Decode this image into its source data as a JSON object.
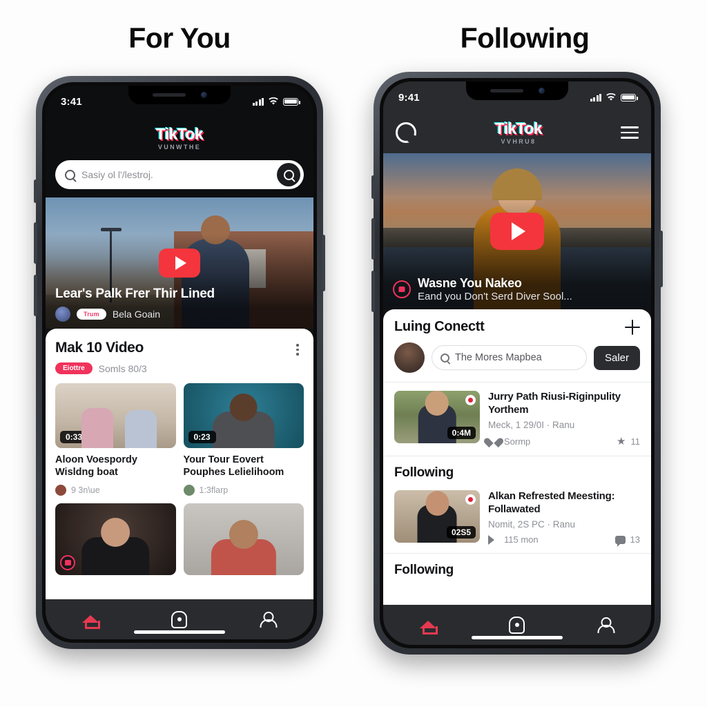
{
  "captions": {
    "left": "For You",
    "right": "Following"
  },
  "brand": {
    "accent_red": "#f4353d",
    "accent_pink": "#f0325c",
    "logo": "TikTok",
    "logo_sub_left": "VUNWTHE",
    "logo_sub_right": "VVHRU8"
  },
  "left_phone": {
    "status": {
      "time": "3:41"
    },
    "search": {
      "placeholder": "Sasiy ol l'/lestroj.",
      "icon": "search-icon",
      "submit_icon": "search-icon"
    },
    "hero": {
      "title": "Lear's Palk Frer Thir Lined",
      "badge": "Trum",
      "byline": "Bela Goain",
      "play_icon": "play-icon"
    },
    "card": {
      "title": "Mak 10 Video",
      "menu_icon": "kebab-menu-icon",
      "badge": "Eiottre",
      "subtitle": "Somls 80/3",
      "videos": [
        {
          "duration": "0:33",
          "title": "Aloon Voespordy Wisldng boat",
          "meta": "9 3n\\ue"
        },
        {
          "duration": "0:23",
          "title": "Your Tour Eovert Pouphes Lelielihoom",
          "meta": "1:3flarp"
        }
      ]
    },
    "nav": [
      {
        "name": "home",
        "icon": "home-icon",
        "active": true
      },
      {
        "name": "discover",
        "icon": "discover-icon",
        "active": false
      },
      {
        "name": "profile",
        "icon": "user-icon",
        "active": false
      }
    ]
  },
  "right_phone": {
    "status": {
      "time": "9:41"
    },
    "header": {
      "left_icon": "logo-icon",
      "menu_icon": "hamburger-menu-icon"
    },
    "hero": {
      "title": "Wasne You Nakeo",
      "subtitle": "Eand you Don't Serd Diver Sool...",
      "play_icon": "play-icon"
    },
    "connect": {
      "title": "Luing Conectt",
      "add_icon": "plus-icon",
      "search_value": "The Mores Mapbea",
      "button": "Saler"
    },
    "items": [
      {
        "title": "Jurry Path Riusi-Riginpulity Yorthem",
        "meta": "Meck, 1 29/0I · Ranu",
        "duration": "0:4M",
        "stat1_icon": "heart-icon",
        "stat1": "Sormp",
        "stat2_icon": "star-icon",
        "stat2": "11"
      },
      {
        "title": "Alkan Refrested Meesting: Follawated",
        "meta": "Nomit, 2S PC · Ranu",
        "duration": "02S5",
        "stat1_icon": "share-icon",
        "stat1": "115 mon",
        "stat2_icon": "comment-icon",
        "stat2": "13"
      }
    ],
    "sections": {
      "first": "Following",
      "second": "Following"
    },
    "nav": [
      {
        "name": "home",
        "icon": "home-icon",
        "active": true
      },
      {
        "name": "discover",
        "icon": "discover-icon",
        "active": false
      },
      {
        "name": "profile",
        "icon": "user-icon",
        "active": false
      }
    ]
  }
}
